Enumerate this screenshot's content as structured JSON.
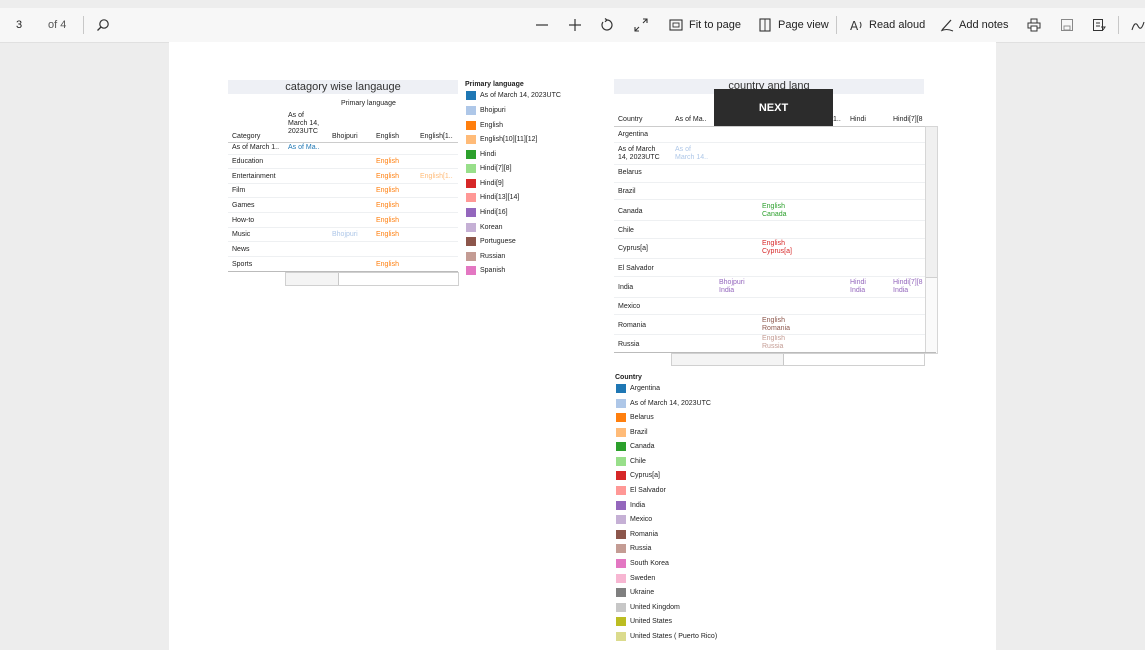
{
  "viewer": {
    "page_number": "3",
    "page_count": "of 4",
    "fit_to_page": "Fit to page",
    "page_view": "Page view",
    "read_aloud": "Read aloud",
    "add_notes": "Add notes"
  },
  "left_viz": {
    "title": "catagory wise langauge",
    "col_group": "Primary language",
    "row_header": "Category",
    "col_headers": [
      "As of\nMarch 14,\n2023UTC",
      "Bhojpuri",
      "English",
      "English[1.."
    ],
    "rows": [
      {
        "label": "As of March 1..",
        "asof": "As of Ma..",
        "bhojpuri": "",
        "english": "",
        "english1": ""
      },
      {
        "label": "Education",
        "asof": "",
        "bhojpuri": "",
        "english": "English",
        "english1": ""
      },
      {
        "label": "Entertainment",
        "asof": "",
        "bhojpuri": "",
        "english": "English",
        "english1": "English[1.."
      },
      {
        "label": "Film",
        "asof": "",
        "bhojpuri": "",
        "english": "English",
        "english1": ""
      },
      {
        "label": "Games",
        "asof": "",
        "bhojpuri": "",
        "english": "English",
        "english1": ""
      },
      {
        "label": "How-to",
        "asof": "",
        "bhojpuri": "",
        "english": "English",
        "english1": ""
      },
      {
        "label": "Music",
        "asof": "",
        "bhojpuri": "Bhojpuri",
        "english": "English",
        "english1": ""
      },
      {
        "label": "News",
        "asof": "",
        "bhojpuri": "",
        "english": "",
        "english1": ""
      },
      {
        "label": "Sports",
        "asof": "",
        "bhojpuri": "",
        "english": "English",
        "english1": ""
      }
    ]
  },
  "language_legend": {
    "title": "Primary language",
    "items": [
      {
        "label": "As of March 14, 2023UTC",
        "color": "#1f77b4"
      },
      {
        "label": "Bhojpuri",
        "color": "#aec7e8"
      },
      {
        "label": "English",
        "color": "#ff7f0e"
      },
      {
        "label": "English[10][11][12]",
        "color": "#ffbb78"
      },
      {
        "label": "Hindi",
        "color": "#2ca02c"
      },
      {
        "label": "Hindi[7][8]",
        "color": "#98df8a"
      },
      {
        "label": "Hindi[9]",
        "color": "#d62728"
      },
      {
        "label": "Hindi[13][14]",
        "color": "#ff9896"
      },
      {
        "label": "Hindi[16]",
        "color": "#9467bd"
      },
      {
        "label": "Korean",
        "color": "#c5b0d5"
      },
      {
        "label": "Portuguese",
        "color": "#8c564b"
      },
      {
        "label": "Russian",
        "color": "#c49c94"
      },
      {
        "label": "Spanish",
        "color": "#e377c2"
      }
    ]
  },
  "right_viz": {
    "title": "country and lang",
    "next_button": "NEXT",
    "row_header": "Country",
    "col_headers": [
      "As of Ma..",
      "Hindi",
      "Hindi[7][8"
    ],
    "col_partial": "1..",
    "rows": [
      {
        "label": "Argentina"
      },
      {
        "label": "As of March\n14, 2023UTC",
        "cells": [
          {
            "col": "asof",
            "text": "As of\nMarch 14..",
            "color": "#aec7e8"
          }
        ]
      },
      {
        "label": "Belarus"
      },
      {
        "label": "Brazil"
      },
      {
        "label": "Canada",
        "cells": [
          {
            "col": "english",
            "text": "English\nCanada",
            "color": "#2ca02c"
          }
        ]
      },
      {
        "label": "Chile"
      },
      {
        "label": "Cyprus[a]",
        "cells": [
          {
            "col": "english",
            "text": "English\nCyprus[a]",
            "color": "#d62728"
          }
        ]
      },
      {
        "label": "El Salvador"
      },
      {
        "label": "India",
        "cells": [
          {
            "col": "bhojpuri",
            "text": "Bhojpuri\nIndia",
            "color": "#9467bd"
          },
          {
            "col": "hindi",
            "text": "Hindi\nIndia",
            "color": "#9467bd"
          },
          {
            "col": "hindi78",
            "text": "Hindi[7][8\nIndia",
            "color": "#9467bd"
          }
        ]
      },
      {
        "label": "Mexico"
      },
      {
        "label": "Romania",
        "cells": [
          {
            "col": "english",
            "text": "English\nRomania",
            "color": "#8c564b"
          }
        ]
      },
      {
        "label": "Russia",
        "cells": [
          {
            "col": "english",
            "text": "English\nRussia",
            "color": "#c49c94"
          }
        ]
      }
    ]
  },
  "country_legend": {
    "title": "Country",
    "items": [
      {
        "label": "Argentina",
        "color": "#1f77b4"
      },
      {
        "label": "As of March 14, 2023UTC",
        "color": "#aec7e8"
      },
      {
        "label": "Belarus",
        "color": "#ff7f0e"
      },
      {
        "label": "Brazil",
        "color": "#ffbb78"
      },
      {
        "label": "Canada",
        "color": "#2ca02c"
      },
      {
        "label": "Chile",
        "color": "#98df8a"
      },
      {
        "label": "Cyprus[a]",
        "color": "#d62728"
      },
      {
        "label": "El Salvador",
        "color": "#ff9896"
      },
      {
        "label": "India",
        "color": "#9467bd"
      },
      {
        "label": "Mexico",
        "color": "#c5b0d5"
      },
      {
        "label": "Romania",
        "color": "#8c564b"
      },
      {
        "label": "Russia",
        "color": "#c49c94"
      },
      {
        "label": "South Korea",
        "color": "#e377c2"
      },
      {
        "label": "Sweden",
        "color": "#f7b6d2"
      },
      {
        "label": "Ukraine",
        "color": "#7f7f7f"
      },
      {
        "label": "United Kingdom",
        "color": "#c7c7c7"
      },
      {
        "label": "United States",
        "color": "#bcbd22"
      },
      {
        "label": "United States ( Puerto Rico)",
        "color": "#dbdb8d"
      }
    ]
  }
}
